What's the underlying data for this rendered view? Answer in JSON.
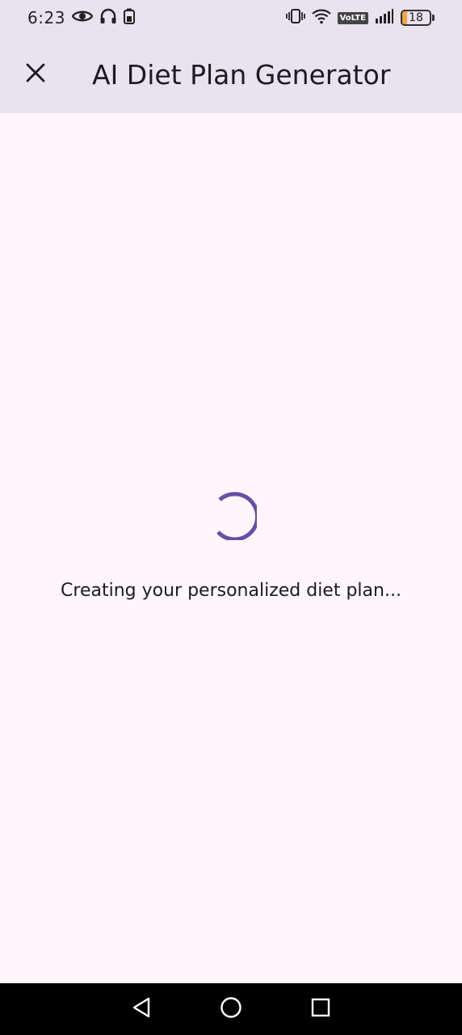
{
  "status_bar": {
    "time": "6:23",
    "battery_level": "18",
    "battery_fraction": 0.18,
    "network_badge": "VoLTE",
    "icons": [
      "eye-icon",
      "headphones-icon",
      "battery-saver-icon",
      "vibrate-icon",
      "wifi-icon",
      "signal-icon",
      "battery-icon"
    ]
  },
  "app_bar": {
    "title": "AI Diet Plan Generator",
    "close_icon": "close-icon",
    "background": "#e8e3ef"
  },
  "content": {
    "loading_message": "Creating your personalized diet plan...",
    "spinner_color": "#6750a4",
    "background": "#fdf7fc"
  },
  "nav_bar": {
    "icons": [
      "back-icon",
      "home-icon",
      "recents-icon"
    ]
  }
}
